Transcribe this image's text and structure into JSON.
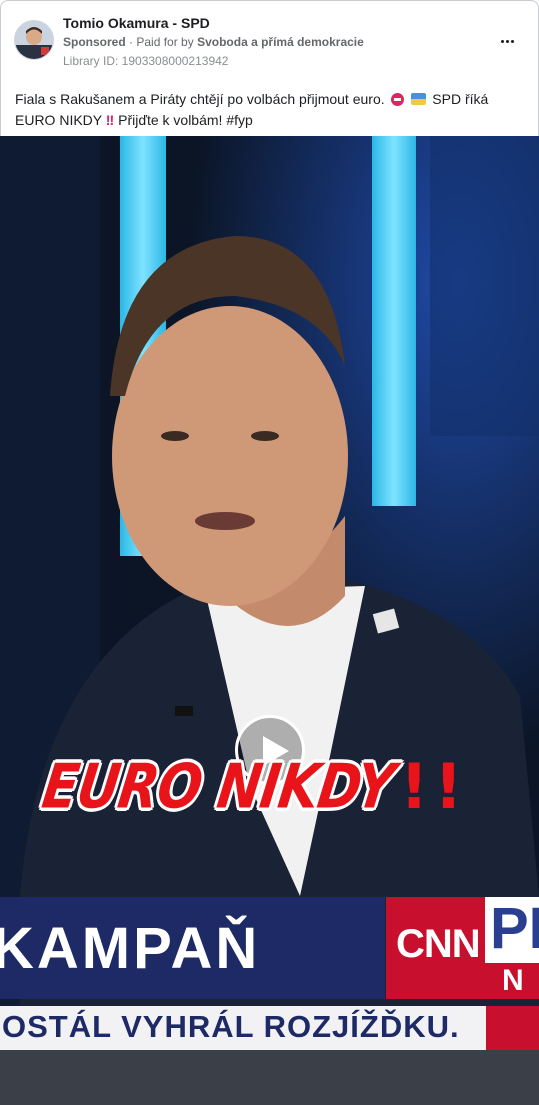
{
  "post": {
    "page_name": "Tomio Okamura - SPD",
    "sponsored_label": "Sponsored",
    "paid_for_prefix": "Paid for by",
    "payer": "Svoboda a přímá demokracie",
    "library_id": "Library ID: 1903308000213942",
    "caption_part1": "Fiala s Rakušanem a Piráty chtějí po volbách přijmout euro.",
    "caption_part2": "SPD říká EURO NIKDY",
    "caption_part3": "Přijďte k volbám! #fyp"
  },
  "video": {
    "overlay_text": "EURO NIKDY",
    "overlay_bangs": "!!",
    "ticker_top": "KAMPAŇ",
    "channel_logo": "CNN",
    "channel_logo2": "PI",
    "channel_logo3": "N",
    "ticker_bottom": "OSTÁL VYHRÁL ROZJÍŽĎKU."
  },
  "colors": {
    "overlay_red": "#e8141a",
    "ticker_blue": "#1d2a66",
    "cnn_red": "#c8102e"
  },
  "icons": [
    "avatar",
    "more-icon",
    "no-entry-emoji",
    "flag-emoji",
    "double-exclamation-emoji",
    "play-icon"
  ]
}
